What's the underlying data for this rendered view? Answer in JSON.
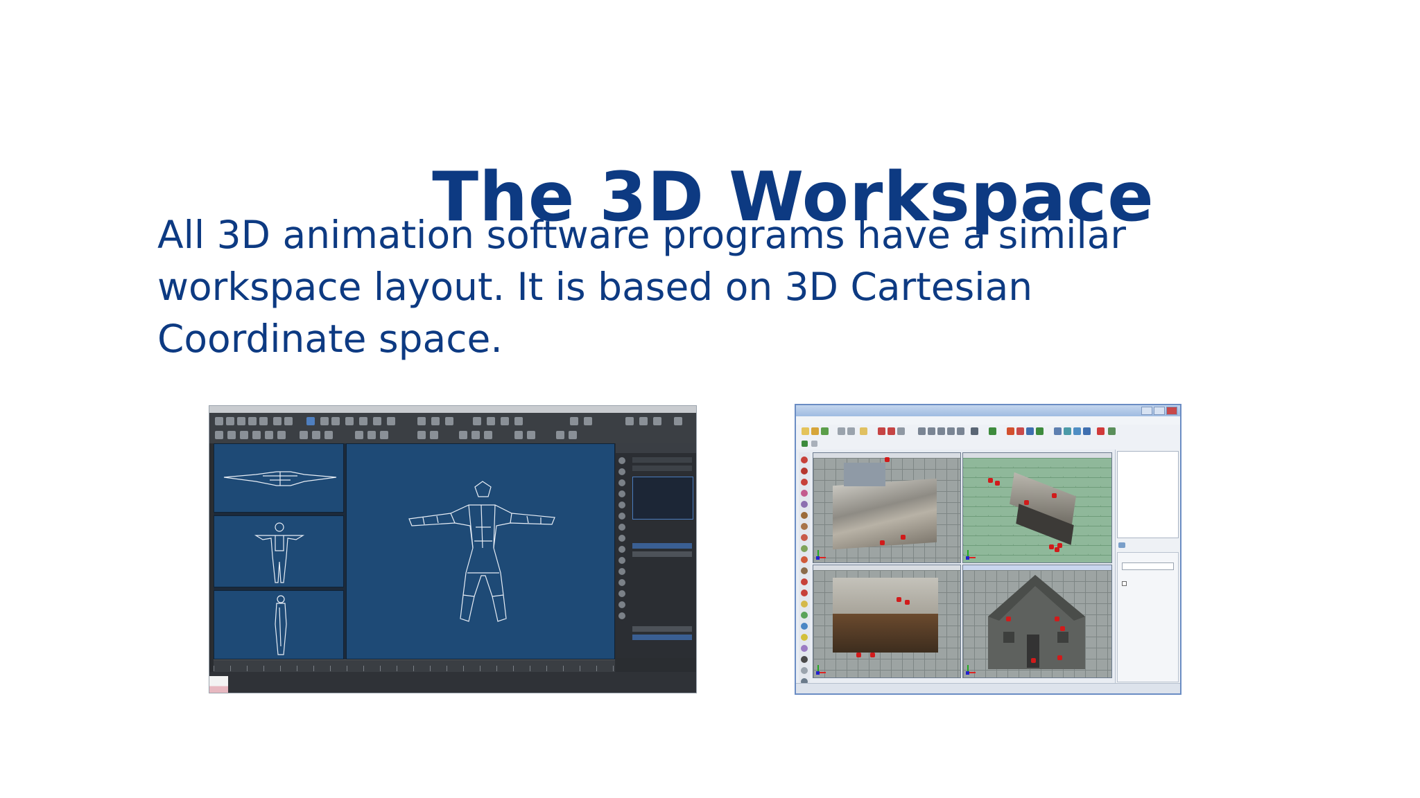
{
  "slide": {
    "title": "The 3D Workspace",
    "body": "All 3D animation software programs have a similar workspace layout. It is based on 3D Cartesian Coordinate space."
  },
  "colors": {
    "heading": "#0d3a82",
    "max_viewport_bg": "#1e4a76",
    "marker_red": "#d11b1b"
  }
}
